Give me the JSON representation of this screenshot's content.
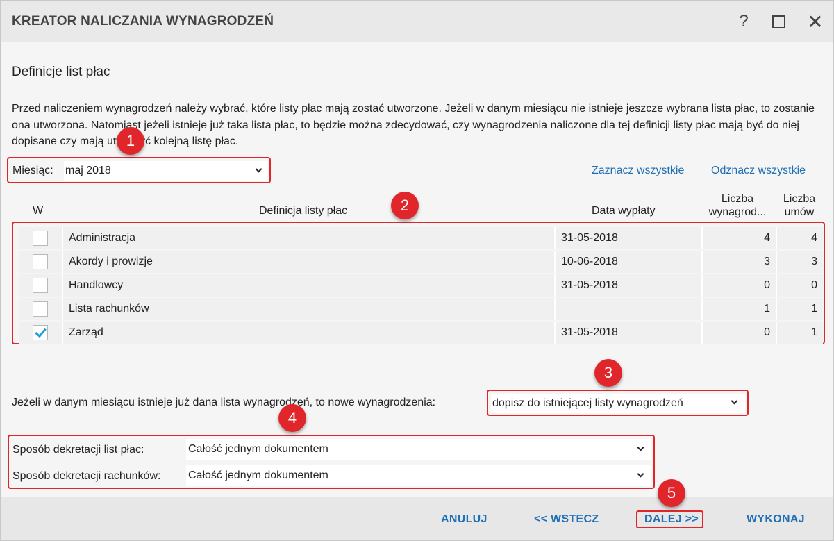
{
  "window": {
    "title": "KREATOR NALICZANIA WYNAGRODZEŃ",
    "help_icon": "?",
    "close_icon": "✕"
  },
  "section_title": "Definicje list płac",
  "intro_text": "Przed naliczeniem wynagrodzeń należy wybrać, które listy płac mają zostać utworzone. Jeżeli w danym miesiącu nie istnieje jeszcze wybrana lista płac, to zostanie ona utworzona. Natomiast jeżeli istnieje już taka lista płac, to będzie można zdecydować, czy wynagrodzenia naliczone dla tej definicji listy płac mają być do niej dopisane czy mają utworzyć kolejną listę płac.",
  "month": {
    "label": "Miesiąc:",
    "value": "maj 2018"
  },
  "links": {
    "select_all": "Zaznacz wszystkie",
    "deselect_all": "Odznacz wszystkie"
  },
  "table": {
    "headers": {
      "w": "W",
      "definition": "Definicja listy płac",
      "date": "Data wypłaty",
      "count_pay_line1": "Liczba",
      "count_pay_line2": "wynagrod...",
      "count_contracts_line1": "Liczba",
      "count_contracts_line2": "umów"
    },
    "rows": [
      {
        "checked": false,
        "name": "Administracja",
        "date": "31-05-2018",
        "salaries": "4",
        "contracts": "4"
      },
      {
        "checked": false,
        "name": "Akordy i prowizje",
        "date": "10-06-2018",
        "salaries": "3",
        "contracts": "3"
      },
      {
        "checked": false,
        "name": "Handlowcy",
        "date": "31-05-2018",
        "salaries": "0",
        "contracts": "0"
      },
      {
        "checked": false,
        "name": "Lista rachunków",
        "date": "",
        "salaries": "1",
        "contracts": "1"
      },
      {
        "checked": true,
        "name": "Zarząd",
        "date": "31-05-2018",
        "salaries": "0",
        "contracts": "1"
      }
    ]
  },
  "existing_list": {
    "label": "Jeżeli w danym miesiącu istnieje już dana lista wynagrodzeń, to nowe wynagrodzenia:",
    "value": "dopisz do istniejącej listy wynagrodzeń"
  },
  "decree": {
    "payroll_label": "Sposób dekretacji list płac:",
    "payroll_value": "Całość jednym dokumentem",
    "bills_label": "Sposób dekretacji rachunków:",
    "bills_value": "Całość jednym dokumentem"
  },
  "footer": {
    "cancel": "ANULUJ",
    "back": "<< WSTECZ",
    "next": "DALEJ >>",
    "execute": "WYKONAJ"
  },
  "badges": [
    "1",
    "2",
    "3",
    "4",
    "5"
  ],
  "colors": {
    "accent": "#1f6fb5",
    "highlight": "#e0262b",
    "check": "#1a9ee0"
  }
}
